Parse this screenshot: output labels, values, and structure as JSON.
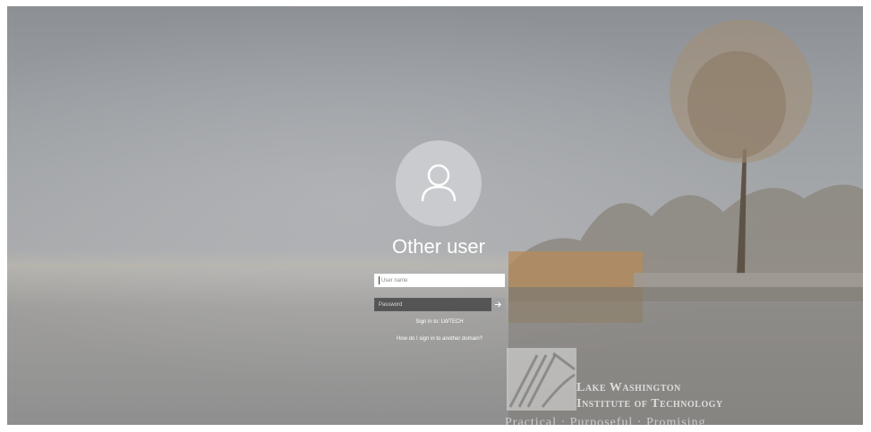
{
  "login": {
    "user_name": "Other user",
    "username_placeholder": "User name",
    "password_placeholder": "Password",
    "sign_in_to": "Sign in to: LWTECH",
    "other_domain_link": "How do I sign in to another domain?"
  },
  "watermark": {
    "line1": "Lake Washington",
    "line2": "Institute of Technology",
    "tagline": "Practical · Purposeful · Promising"
  },
  "icons": {
    "avatar": "user-icon",
    "submit": "arrow-right-icon",
    "logo": "lwtech-logo-icon"
  },
  "colors": {
    "avatar_bg": "#c9cbce",
    "password_bg": "#464648",
    "text": "#ffffff"
  }
}
